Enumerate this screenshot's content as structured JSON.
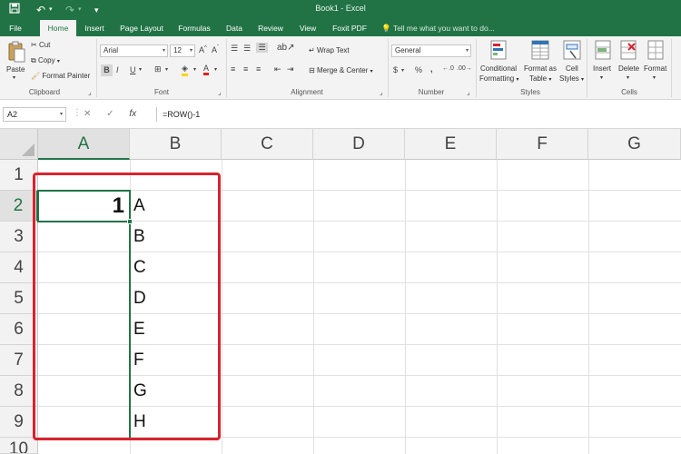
{
  "window": {
    "title": "Book1 - Excel"
  },
  "quick_access": {
    "save_icon": "save-icon",
    "undo_icon": "undo-icon",
    "redo_icon": "redo-icon"
  },
  "tabs": [
    {
      "label": "File"
    },
    {
      "label": "Home",
      "active": true
    },
    {
      "label": "Insert"
    },
    {
      "label": "Page Layout"
    },
    {
      "label": "Formulas"
    },
    {
      "label": "Data"
    },
    {
      "label": "Review"
    },
    {
      "label": "View"
    },
    {
      "label": "Foxit PDF"
    }
  ],
  "tell_me": "Tell me what you want to do...",
  "ribbon": {
    "clipboard": {
      "label": "Clipboard",
      "paste": "Paste",
      "cut": "Cut",
      "copy": "Copy",
      "format_painter": "Format Painter"
    },
    "font": {
      "label": "Font",
      "font_name": "Arial",
      "font_size": "12",
      "bold": "B",
      "italic": "I",
      "underline": "U"
    },
    "alignment": {
      "label": "Alignment",
      "wrap_text": "Wrap Text",
      "merge_center": "Merge & Center"
    },
    "number": {
      "label": "Number",
      "format": "General",
      "currency": "$",
      "percent": "%",
      "comma": ","
    },
    "styles": {
      "label": "Styles",
      "conditional": "Conditional",
      "formatting": "Formatting",
      "format_as": "Format as",
      "table": "Table",
      "cell": "Cell",
      "styles_btn": "Styles"
    },
    "cells": {
      "label": "Cells",
      "insert": "Insert",
      "delete": "Delete",
      "format": "Format"
    }
  },
  "formula_bar": {
    "name_box": "A2",
    "formula": "=ROW()-1",
    "fx": "fx",
    "cancel": "✕",
    "enter": "✓"
  },
  "grid": {
    "columns": [
      "A",
      "B",
      "C",
      "D",
      "E",
      "F",
      "G"
    ],
    "rows": [
      "1",
      "2",
      "3",
      "4",
      "5",
      "6",
      "7",
      "8",
      "9",
      "10"
    ],
    "cells": {
      "A2": "1",
      "B2": "A",
      "B3": "B",
      "B4": "C",
      "B5": "D",
      "B6": "E",
      "B7": "F",
      "B8": "G",
      "B9": "H"
    },
    "selected_cell": "A2"
  },
  "colors": {
    "accent": "#217346",
    "highlight": "#d9232e"
  }
}
